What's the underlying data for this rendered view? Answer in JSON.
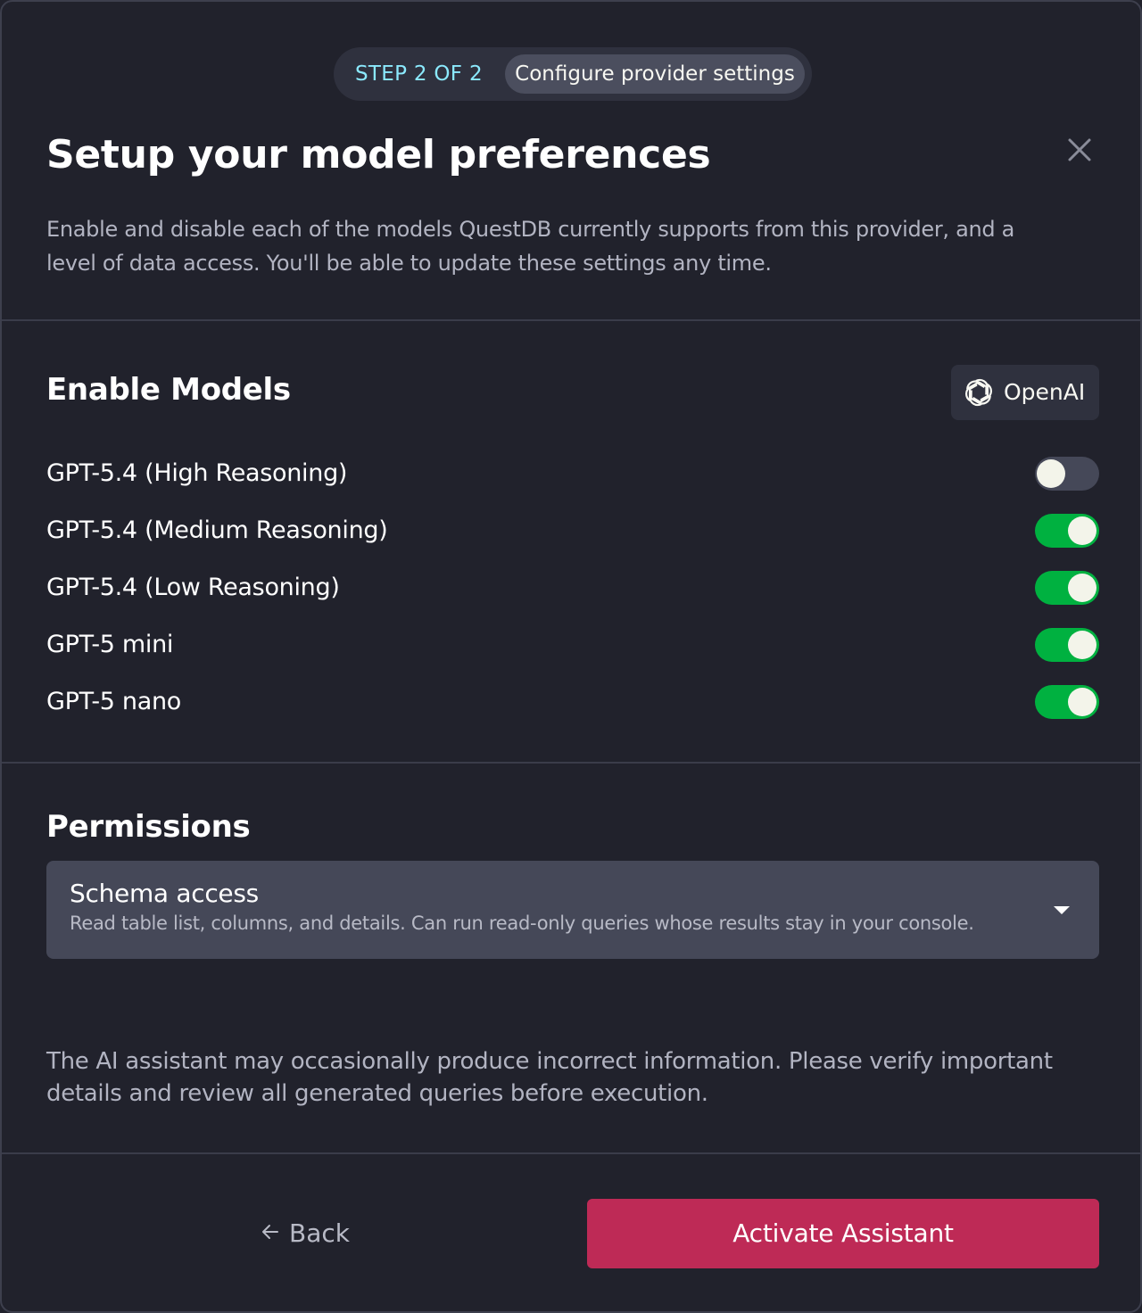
{
  "header": {
    "step_label": "STEP 2 OF 2",
    "step_chip": "Configure provider settings",
    "title": "Setup your model preferences",
    "description": "Enable and disable each of the models QuestDB currently supports from this provider, and a level of data access. You'll be able to update these settings any time.",
    "close_icon": "close-icon"
  },
  "models_section": {
    "title": "Enable Models",
    "provider": {
      "name": "OpenAI",
      "icon": "openai-logo-icon"
    },
    "models": [
      {
        "name": "GPT-5.4 (High Reasoning)",
        "enabled": false
      },
      {
        "name": "GPT-5.4 (Medium Reasoning)",
        "enabled": true
      },
      {
        "name": "GPT-5.4 (Low Reasoning)",
        "enabled": true
      },
      {
        "name": "GPT-5 mini",
        "enabled": true
      },
      {
        "name": "GPT-5 nano",
        "enabled": true
      }
    ]
  },
  "permissions": {
    "title": "Permissions",
    "selected_title": "Schema access",
    "selected_description": "Read table list, columns, and details. Can run read-only queries whose results stay in your console.",
    "dropdown_icon": "caret-down-icon"
  },
  "disclaimer": "The AI assistant may occasionally produce incorrect information. Please verify important details and review all generated queries before execution.",
  "footer": {
    "back_label": "Back",
    "back_icon": "arrow-left-icon",
    "activate_label": "Activate Assistant"
  },
  "colors": {
    "background": "#21222c",
    "accent_step": "#8be9fd",
    "toggle_on": "#00b140",
    "toggle_off": "#454858",
    "primary_button": "#be2a56"
  }
}
